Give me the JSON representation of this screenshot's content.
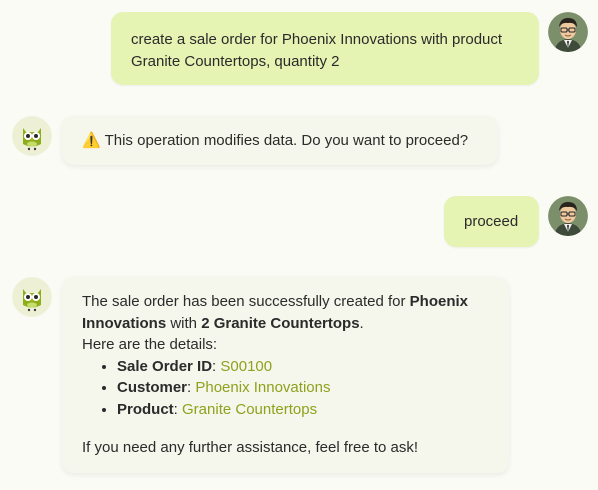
{
  "messages": {
    "user1": {
      "text": "create a sale order for Phoenix Innovations with product Granite Countertops, quantity 2"
    },
    "bot1": {
      "warning_icon": "⚠️",
      "text": "This operation modifies data. Do you want to proceed?"
    },
    "user2": {
      "text": "proceed"
    },
    "bot2": {
      "intro_pre": "The sale order has been successfully created for ",
      "customer_bold": "Phoenix Innovations",
      "intro_mid": " with ",
      "quantity_bold": "2 Granite Countertops",
      "intro_end": ".",
      "details_line": "Here are the details:",
      "details": [
        {
          "label": "Sale Order ID",
          "sep": ": ",
          "value": "S00100"
        },
        {
          "label": "Customer",
          "sep": ": ",
          "value": "Phoenix Innovations"
        },
        {
          "label": "Product",
          "sep": ": ",
          "value": "Granite Countertops"
        }
      ],
      "closing": "If you need any further assistance, feel free to ask!"
    }
  },
  "avatars": {
    "user": "user-avatar-icon",
    "bot": "owl-avatar-icon"
  },
  "colors": {
    "user_bubble": "#e5f3b3",
    "bot_bubble": "#f5f7ec",
    "link": "#8fa11d",
    "background": "#fbfbf6"
  }
}
